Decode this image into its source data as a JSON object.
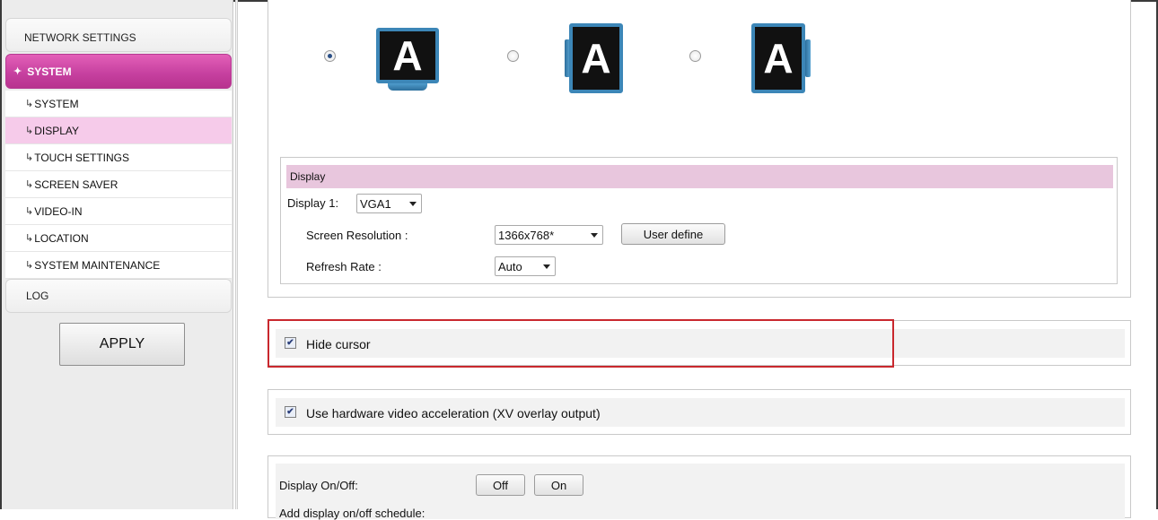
{
  "sidebar": {
    "network_settings": "NETWORK SETTINGS",
    "system_section": "SYSTEM",
    "items": [
      {
        "label": "SYSTEM"
      },
      {
        "label": "DISPLAY"
      },
      {
        "label": "TOUCH SETTINGS"
      },
      {
        "label": "SCREEN SAVER"
      },
      {
        "label": "VIDEO-IN"
      },
      {
        "label": "LOCATION"
      },
      {
        "label": "SYSTEM MAINTENANCE"
      }
    ],
    "log": "LOG",
    "apply": "APPLY",
    "active_item": "DISPLAY"
  },
  "orientation": {
    "options": [
      {
        "glyph": "A",
        "orientation": "landscape",
        "selected": true
      },
      {
        "glyph": "A",
        "orientation": "portrait",
        "selected": false
      },
      {
        "glyph": "A",
        "orientation": "portrait",
        "selected": false
      }
    ]
  },
  "display": {
    "section_title": "Display",
    "display_label": "Display 1:",
    "display_value": "VGA1",
    "resolution_label": "Screen Resolution :",
    "resolution_value": "1366x768*",
    "user_define": "User define",
    "refresh_label": "Refresh Rate :",
    "refresh_value": "Auto"
  },
  "options": {
    "hide_cursor": {
      "label": "Hide cursor",
      "checked": true
    },
    "hw_accel": {
      "label": "Use hardware video acceleration (XV overlay output)",
      "checked": true
    }
  },
  "power": {
    "label": "Display On/Off:",
    "off": "Off",
    "on": "On",
    "schedule_label": "Add display on/off schedule:"
  },
  "colors": {
    "accent": "#c53f9e",
    "active_item_bg": "#f6cbea",
    "section_bar": "#e8c6dd",
    "highlight_border": "#c9282e",
    "monitor_frame": "#3c86b7"
  }
}
